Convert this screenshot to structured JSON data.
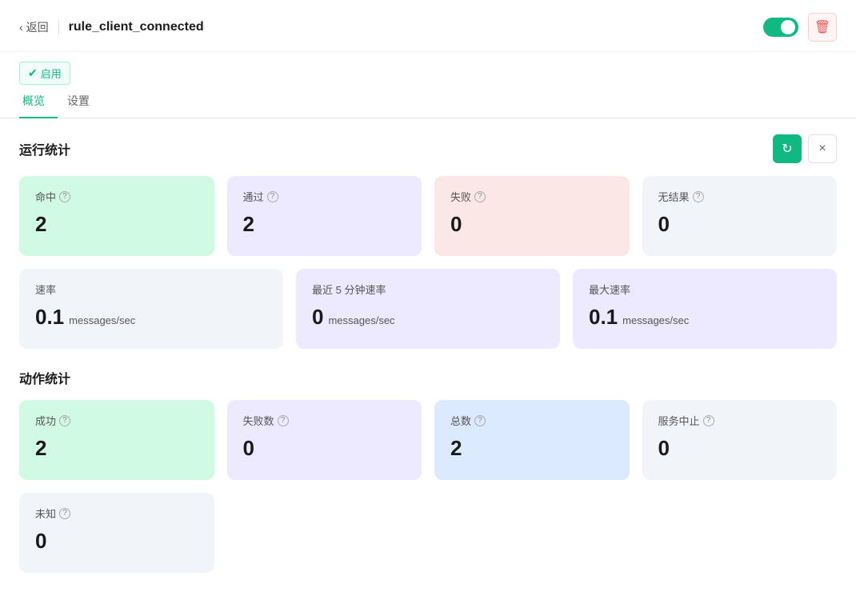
{
  "header": {
    "back_label": "返回",
    "title": "rule_client_connected",
    "enabled_label": "启用",
    "toggle_on": true
  },
  "tabs": [
    {
      "id": "overview",
      "label": "概览",
      "active": true
    },
    {
      "id": "settings",
      "label": "设置",
      "active": false
    }
  ],
  "run_stats": {
    "title": "运行统计",
    "cards": [
      {
        "label": "命中",
        "value": "2",
        "color": "green"
      },
      {
        "label": "通过",
        "value": "2",
        "color": "purple"
      },
      {
        "label": "失败",
        "value": "0",
        "color": "red-light"
      },
      {
        "label": "无结果",
        "value": "0",
        "color": "gray-light"
      }
    ],
    "rate_cards": [
      {
        "label": "速率",
        "value": "0.1",
        "unit": "messages/sec",
        "color": "gray-light"
      },
      {
        "label": "最近 5 分钟速率",
        "value": "0",
        "unit": "messages/sec",
        "color": "purple"
      },
      {
        "label": "最大速率",
        "value": "0.1",
        "unit": "messages/sec",
        "color": "lavender"
      }
    ]
  },
  "action_stats": {
    "title": "动作统计",
    "cards": [
      {
        "label": "成功",
        "value": "2",
        "color": "green"
      },
      {
        "label": "失败数",
        "value": "0",
        "color": "purple"
      },
      {
        "label": "总数",
        "value": "2",
        "color": "blue-light"
      },
      {
        "label": "服务中止",
        "value": "0",
        "color": "gray-light"
      }
    ],
    "extra_cards": [
      {
        "label": "未知",
        "value": "0",
        "color": "gray-light"
      }
    ]
  },
  "icons": {
    "refresh": "↻",
    "close": "×",
    "delete": "🗑",
    "check": "✔",
    "back_arrow": "‹",
    "help": "?"
  }
}
